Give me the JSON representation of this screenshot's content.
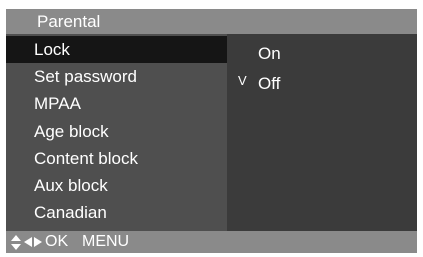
{
  "title": "Parental",
  "menu": {
    "items": [
      {
        "label": "Lock"
      },
      {
        "label": "Set password"
      },
      {
        "label": "MPAA"
      },
      {
        "label": "Age block"
      },
      {
        "label": "Content block"
      },
      {
        "label": "Aux block"
      },
      {
        "label": "Canadian"
      }
    ],
    "selected": "Lock"
  },
  "options": {
    "items": [
      {
        "label": "On",
        "check": ""
      },
      {
        "label": "Off",
        "check": "V"
      }
    ],
    "current": "Off"
  },
  "footer": {
    "icons": [
      "up-down-arrows-icon",
      "left-right-arrows-icon"
    ],
    "ok_label": "OK",
    "menu_label": "MENU"
  },
  "colors": {
    "title_bar": "#8a8a8a",
    "menu_panel": "#4f4f4f",
    "options_panel": "#3b3b3b",
    "selected_row": "#151515",
    "text": "#ffffff"
  }
}
